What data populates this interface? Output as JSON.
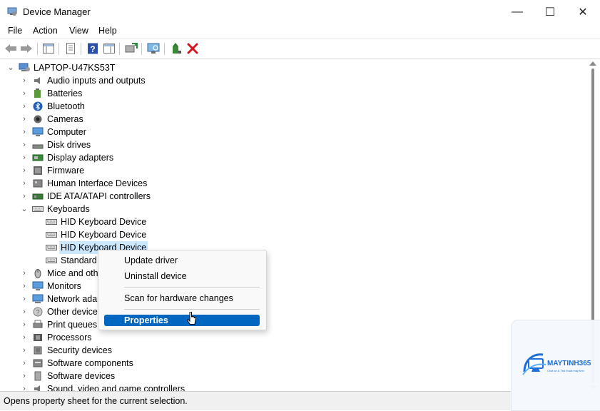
{
  "window": {
    "title": "Device Manager",
    "minimize_glyph": "—",
    "maximize_glyph": "☐",
    "close_glyph": "✕"
  },
  "menu": [
    "File",
    "Action",
    "View",
    "Help"
  ],
  "toolbar_icons": [
    "back-arrow-icon",
    "forward-arrow-icon",
    "show-hide-console-tree-icon",
    "properties-icon",
    "help-icon",
    "action-pane-icon",
    "update-driver-icon",
    "scan-hardware-icon",
    "enable-device-icon",
    "uninstall-device-icon"
  ],
  "tree": {
    "root": "LAPTOP-U47KS53T",
    "categories": [
      {
        "label": "Audio inputs and outputs",
        "icon": "speaker-icon"
      },
      {
        "label": "Batteries",
        "icon": "battery-icon"
      },
      {
        "label": "Bluetooth",
        "icon": "bluetooth-icon"
      },
      {
        "label": "Cameras",
        "icon": "camera-icon"
      },
      {
        "label": "Computer",
        "icon": "computer-icon"
      },
      {
        "label": "Disk drives",
        "icon": "disk-drive-icon"
      },
      {
        "label": "Display adapters",
        "icon": "display-adapter-icon"
      },
      {
        "label": "Firmware",
        "icon": "firmware-icon"
      },
      {
        "label": "Human Interface Devices",
        "icon": "hid-icon"
      },
      {
        "label": "IDE ATA/ATAPI controllers",
        "icon": "ide-controller-icon"
      },
      {
        "label": "Keyboards",
        "icon": "keyboard-icon",
        "expanded": true
      },
      {
        "label": "Mice and oth",
        "icon": "mouse-icon"
      },
      {
        "label": "Monitors",
        "icon": "monitor-icon"
      },
      {
        "label": "Network adap",
        "icon": "network-adapter-icon"
      },
      {
        "label": "Other devices",
        "icon": "other-devices-icon"
      },
      {
        "label": "Print queues",
        "icon": "printer-icon"
      },
      {
        "label": "Processors",
        "icon": "processor-icon"
      },
      {
        "label": "Security devices",
        "icon": "security-device-icon"
      },
      {
        "label": "Software components",
        "icon": "software-component-icon"
      },
      {
        "label": "Software devices",
        "icon": "software-device-icon"
      },
      {
        "label": "Sound, video and game controllers",
        "icon": "sound-controller-icon"
      }
    ],
    "keyboards": [
      "HID Keyboard Device",
      "HID Keyboard Device",
      "HID Keyboard Device",
      "Standard"
    ]
  },
  "context_menu": {
    "update_driver": "Update driver",
    "uninstall_device": "Uninstall device",
    "scan": "Scan for hardware changes",
    "properties": "Properties"
  },
  "status": "Opens property sheet for the current selection.",
  "watermark": {
    "brand": "MAYTINH365",
    "tagline": "Chia sẻ & Thủ thuật máy tính"
  },
  "colors": {
    "selection": "#cce8ff",
    "menu_highlight": "#0067c0",
    "uninstall_red": "#d4141f"
  }
}
